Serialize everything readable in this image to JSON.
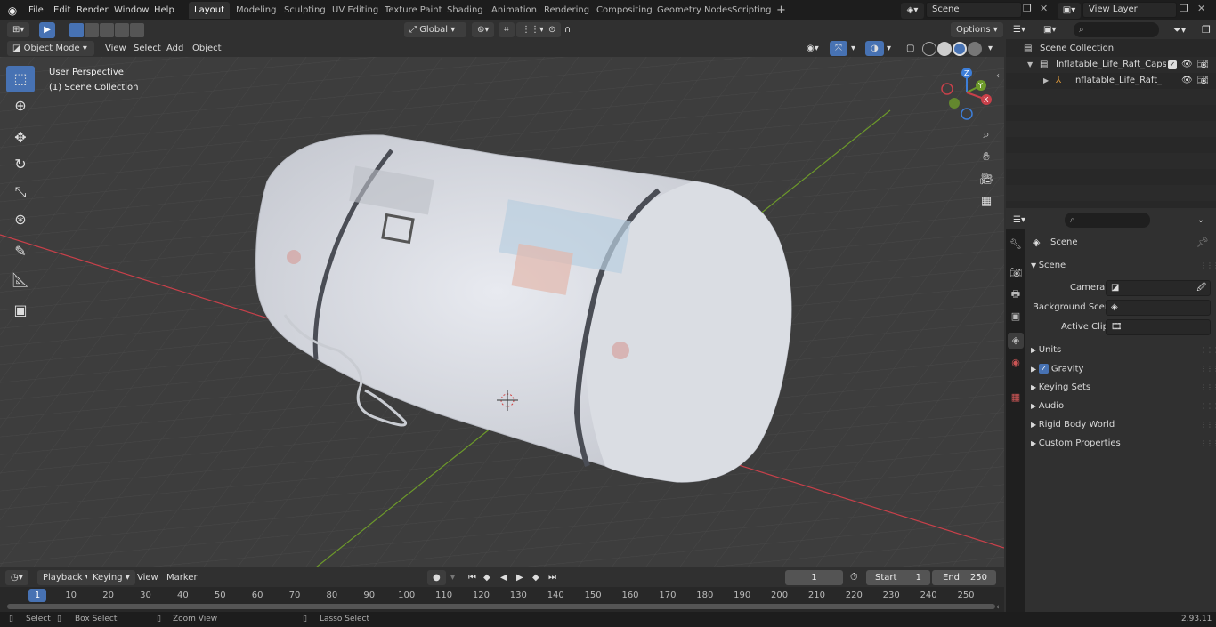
{
  "topbar": {
    "menus": [
      "File",
      "Edit",
      "Render",
      "Window",
      "Help"
    ],
    "workspaces": [
      "Layout",
      "Modeling",
      "Sculpting",
      "UV Editing",
      "Texture Paint",
      "Shading",
      "Animation",
      "Rendering",
      "Compositing",
      "Geometry Nodes",
      "Scripting"
    ],
    "active_workspace": "Layout",
    "scene_field": "Scene",
    "view_layer_field": "View Layer",
    "add_tab_label": "+"
  },
  "viewport_header": {
    "mode": "Object Mode",
    "menus": [
      "View",
      "Select",
      "Add",
      "Object"
    ],
    "transform_orientation": "Global",
    "options_label": "Options"
  },
  "viewport": {
    "perspective_label": "User Perspective",
    "collection_label": "(1) Scene Collection",
    "gizmo": {
      "x": "X",
      "y": "Y",
      "z": "Z"
    }
  },
  "outliner": {
    "rows": [
      {
        "label": "Scene Collection"
      },
      {
        "label": "Inflatable_Life_Raft_Capsule_"
      },
      {
        "label": "Inflatable_Life_Raft_Caps"
      }
    ]
  },
  "properties": {
    "header": "Scene",
    "section": "Scene",
    "fields": [
      {
        "label": "Camera",
        "value": ""
      },
      {
        "label": "Background Scene",
        "value": ""
      },
      {
        "label": "Active Clip",
        "value": ""
      }
    ],
    "panels": [
      "Units",
      "Gravity",
      "Keying Sets",
      "Audio",
      "Rigid Body World",
      "Custom Properties"
    ],
    "gravity_enabled": true
  },
  "timeline": {
    "menus": [
      "Playback",
      "Keying",
      "View",
      "Marker"
    ],
    "current_frame": "1",
    "start_label": "Start",
    "start_value": "1",
    "end_label": "End",
    "end_value": "250",
    "ticks": [
      "1",
      "10",
      "20",
      "30",
      "40",
      "50",
      "60",
      "70",
      "80",
      "90",
      "100",
      "110",
      "120",
      "130",
      "140",
      "150",
      "160",
      "170",
      "180",
      "190",
      "200",
      "210",
      "220",
      "230",
      "240",
      "250"
    ]
  },
  "statusbar": {
    "items": [
      "Select",
      "Box Select",
      "Zoom View",
      "Lasso Select"
    ],
    "version": "2.93.11"
  },
  "colors": {
    "accent": "#4772b3",
    "x_axis": "#c8404a",
    "y_axis": "#6d9a2a",
    "z_axis": "#3d7ed8"
  }
}
